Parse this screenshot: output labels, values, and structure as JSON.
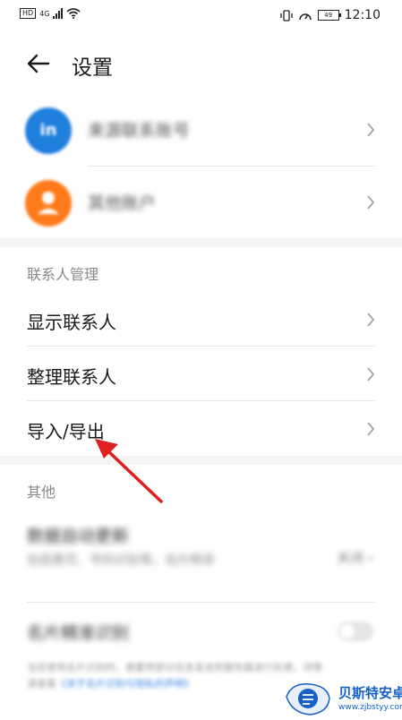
{
  "status": {
    "left_chip": "HD",
    "net": "4G",
    "battery": "49",
    "time": "12:10"
  },
  "header": {
    "title": "设置"
  },
  "accounts": [
    {
      "label": "来源联系账号",
      "color": "#1f7fdd",
      "icon": "in"
    },
    {
      "label": "其他账户",
      "color": "#ff7a1a",
      "icon": "person-icon"
    }
  ],
  "contacts": {
    "section": "联系人管理",
    "items": [
      {
        "label": "显示联系人"
      },
      {
        "label": "整理联系人"
      },
      {
        "label": "导入/导出"
      }
    ]
  },
  "other": {
    "section": "其他",
    "auto_update_title": "数据自动更新",
    "auto_update_sub": "包括黄页、号码识别等，名片畅享",
    "auto_update_value": "关闭 ›",
    "card_title": "名片精准识别",
    "card_desc_a": "当您使用名片识别时，需要将部分信息发送到服务器进行处理，详情请查看",
    "card_desc_link": "《关于名片识别与隐私的声明》"
  },
  "watermark": {
    "name": "贝斯特安卓网",
    "url": "www.zjbstyy.com"
  },
  "colors": {
    "arrow": "#e02020",
    "watermark": "#1660c6"
  }
}
